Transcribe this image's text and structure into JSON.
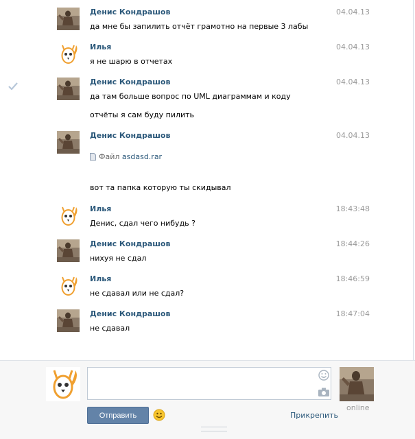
{
  "messages": [
    {
      "author": "Денис Кондрашов",
      "avatar": "photo",
      "date": "04.04.13",
      "lines": [
        "да мне бы запилить отчёт грамотно на первые 3 лабы"
      ]
    },
    {
      "author": "Илья",
      "avatar": "owl",
      "date": "04.04.13",
      "lines": [
        "я не шарю в отчетах"
      ]
    },
    {
      "author": "Денис Кондрашов",
      "avatar": "photo",
      "date": "04.04.13",
      "lines": [
        "да там больше вопрос по UML диаграммам и коду",
        "отчёты я сам буду пилить"
      ]
    },
    {
      "author": "Денис Кондрашов",
      "avatar": "photo",
      "date": "04.04.13",
      "file_label": "Файл",
      "file_name": "asdasd.rar",
      "lines": [
        "вот та папка которую ты скидывал"
      ]
    },
    {
      "author": "Илья",
      "avatar": "owl",
      "date": "18:43:48",
      "lines": [
        "Денис, сдал чего нибудь ?"
      ]
    },
    {
      "author": "Денис Кондрашов",
      "avatar": "photo",
      "date": "18:44:26",
      "lines": [
        "нихуя не сдал"
      ]
    },
    {
      "author": "Илья",
      "avatar": "owl",
      "date": "18:46:59",
      "lines": [
        "не сдавал или не сдал?"
      ]
    },
    {
      "author": "Денис Кондрашов",
      "avatar": "photo",
      "date": "18:47:04",
      "lines": [
        "не сдавал"
      ]
    }
  ],
  "composer": {
    "send_label": "Отправить",
    "attach_label": "Прикрепить",
    "status": "online"
  },
  "icons": {
    "read_check": "checkmark-icon",
    "emoji": "smiley-icon",
    "camera": "camera-icon",
    "file": "document-icon"
  },
  "colors": {
    "author": "#2b587a",
    "send_button": "#6383a8",
    "owl": "#f0a030"
  }
}
